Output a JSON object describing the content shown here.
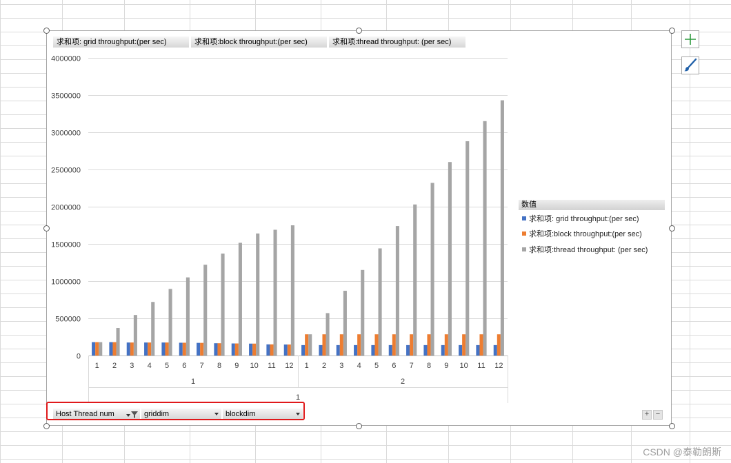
{
  "colors": {
    "grid": "#4472c4",
    "block": "#ed7d31",
    "thread": "#a5a5a5",
    "highlight": "#e0191b"
  },
  "value_field_buttons": [
    "求和项: grid throughput:(per sec)",
    "求和项:block throughput:(per sec)",
    "求和项:thread throughput: (per sec)"
  ],
  "axis_field_buttons": {
    "host_thread_num": "Host Thread num",
    "griddim": "griddim",
    "blockdim": "blockdim"
  },
  "legend": {
    "title": "数值",
    "items": [
      "求和项: grid throughput:(per sec)",
      "求和项:block throughput:(per sec)",
      "求和项:thread throughput: (per sec)"
    ]
  },
  "tools": {
    "add_element_icon": "plus-icon",
    "style_icon": "brush-icon",
    "expand_label": "+",
    "collapse_label": "−"
  },
  "watermark": "CSDN @泰勒朗斯",
  "chart_data": {
    "type": "bar",
    "ylim": [
      0,
      4000000
    ],
    "yticks": [
      0,
      500000,
      1000000,
      1500000,
      2000000,
      2500000,
      3000000,
      3500000,
      4000000
    ],
    "grid": true,
    "legend_position": "right",
    "outer_category": "1",
    "groups": [
      {
        "label": "1",
        "categories": [
          "1",
          "2",
          "3",
          "4",
          "5",
          "6",
          "7",
          "8",
          "9",
          "10",
          "11",
          "12"
        ],
        "series": [
          {
            "name": "求和项: grid throughput:(per sec)",
            "values": [
              180000,
              180000,
              175000,
              175000,
              175000,
              172000,
              170000,
              165000,
              162000,
              160000,
              150000,
              148000
            ]
          },
          {
            "name": "求和项:block throughput:(per sec)",
            "values": [
              180000,
              180000,
              175000,
              175000,
              175000,
              172000,
              170000,
              165000,
              162000,
              160000,
              150000,
              148000
            ]
          },
          {
            "name": "求和项:thread throughput: (per sec)",
            "values": [
              180000,
              370000,
              545000,
              720000,
              895000,
              1050000,
              1220000,
              1370000,
              1515000,
              1640000,
              1690000,
              1750000
            ]
          }
        ]
      },
      {
        "label": "2",
        "categories": [
          "1",
          "2",
          "3",
          "4",
          "5",
          "6",
          "7",
          "8",
          "9",
          "10",
          "11",
          "12"
        ],
        "series": [
          {
            "name": "求和项: grid throughput:(per sec)",
            "values": [
              140000,
              140000,
              140000,
              140000,
              140000,
              140000,
              140000,
              140000,
              140000,
              140000,
              140000,
              140000
            ]
          },
          {
            "name": "求和项:block throughput:(per sec)",
            "values": [
              285000,
              285000,
              285000,
              285000,
              285000,
              285000,
              285000,
              285000,
              285000,
              285000,
              285000,
              285000
            ]
          },
          {
            "name": "求和项:thread throughput: (per sec)",
            "values": [
              285000,
              570000,
              870000,
              1150000,
              1440000,
              1740000,
              2030000,
              2320000,
              2600000,
              2880000,
              3150000,
              3430000
            ]
          }
        ]
      }
    ]
  }
}
